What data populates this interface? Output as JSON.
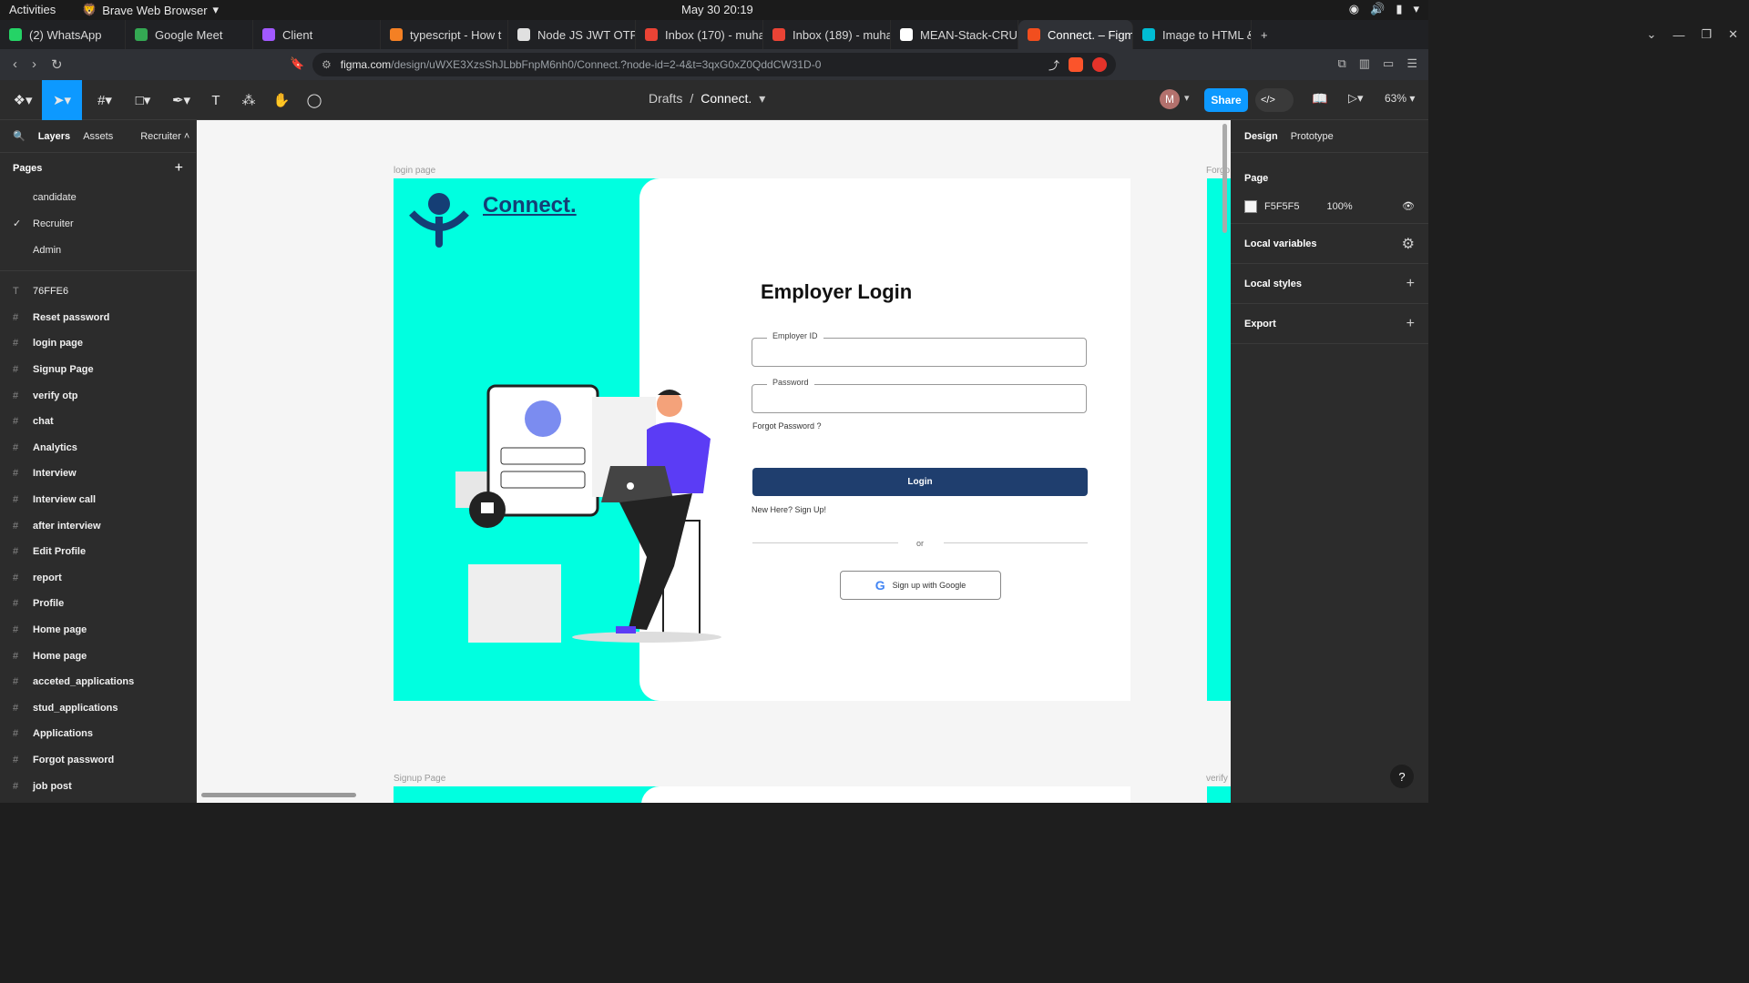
{
  "os": {
    "activities": "Activities",
    "browser_name": "Brave Web Browser",
    "clock": "May 30  20:19"
  },
  "tabs": [
    {
      "label": "(2) WhatsApp",
      "color": "#25d366"
    },
    {
      "label": "Google Meet",
      "color": "#34a853"
    },
    {
      "label": "Client",
      "color": "#a259ff"
    },
    {
      "label": "typescript - How t",
      "color": "#f48024"
    },
    {
      "label": "Node JS JWT OTP",
      "color": "#e0e0e0"
    },
    {
      "label": "Inbox (170) - muha",
      "color": "#ea4335"
    },
    {
      "label": "Inbox (189) - muha",
      "color": "#ea4335"
    },
    {
      "label": "MEAN-Stack-CRUD",
      "color": "#ffffff"
    },
    {
      "label": "Connect. – Figm",
      "color": "#f24e1e"
    },
    {
      "label": "Image to HTML &",
      "color": "#00bcd4"
    }
  ],
  "url": {
    "domain": "figma.com",
    "path": "/design/uWXE3XzsShJLbbFnpM6nh0/Connect.?node-id=2-4&t=3qxG0xZ0QddCW31D-0"
  },
  "toolbar": {
    "breadcrumb_drafts": "Drafts",
    "breadcrumb_sep": "/",
    "file_name": "Connect.",
    "avatar": "M",
    "share": "Share",
    "zoom": "63%"
  },
  "left": {
    "tab_layers": "Layers",
    "tab_assets": "Assets",
    "page_selector": "Recruiter",
    "pages_heading": "Pages",
    "pages": [
      "candidate",
      "Recruiter",
      "Admin"
    ],
    "layers": [
      "76FFE6",
      "Reset password",
      "login page",
      "Signup Page",
      "verify otp",
      "chat",
      "Analytics",
      "Interview",
      "Interview call",
      "after interview",
      "Edit Profile",
      "report",
      "Profile",
      "Home page",
      "Home page",
      "acceted_applications",
      "stud_applications",
      "Applications",
      "Forgot password",
      "job post"
    ]
  },
  "canvas": {
    "frame_label_login": "login page",
    "frame_label_signup": "Signup Page",
    "frame_label_forgot": "Forgo",
    "frame_label_verify": "verify",
    "logo": "Connect.",
    "title": "Employer Login",
    "field1_label": "Employer ID",
    "field2_label": "Password",
    "forgot": "Forgot Password ?",
    "login_btn": "Login",
    "new_here": "New Here? Sign Up!",
    "or": "or",
    "google_btn": "Sign up with Google",
    "frame_bg": "#00ffe0",
    "btn_color": "#1f3e6e"
  },
  "right": {
    "tab_design": "Design",
    "tab_prototype": "Prototype",
    "page_heading": "Page",
    "bg_hex": "F5F5F5",
    "bg_opacity": "100%",
    "local_variables": "Local variables",
    "local_styles": "Local styles",
    "export": "Export"
  }
}
